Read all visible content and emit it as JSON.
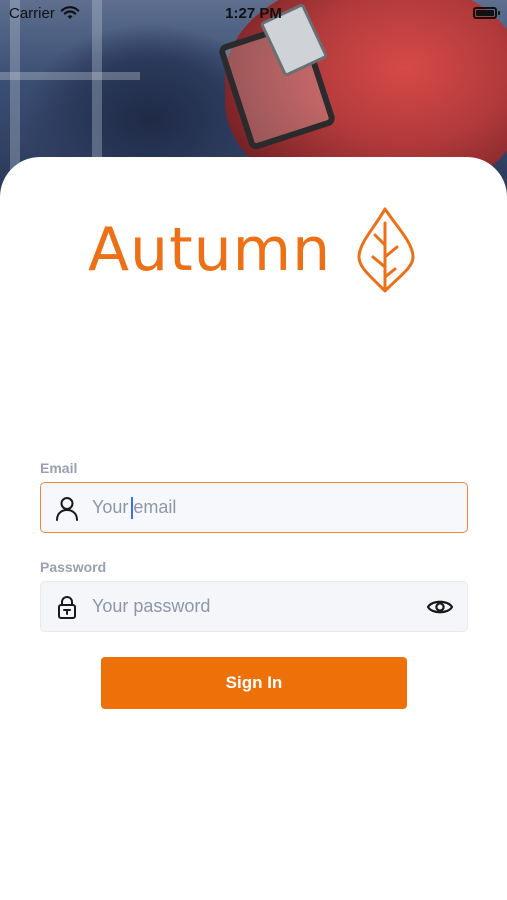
{
  "status_bar": {
    "carrier": "Carrier",
    "time": "1:27 PM"
  },
  "logo": {
    "text": "Autumn",
    "icon": "leaf-icon",
    "color": "#ee7016"
  },
  "email": {
    "label": "Email",
    "placeholder": "Your email",
    "value": "",
    "icon": "user-icon"
  },
  "password": {
    "label": "Password",
    "placeholder": "Your password",
    "value": "",
    "icon": "lock-icon",
    "toggle_icon": "eye-icon"
  },
  "sign_in": {
    "label": "Sign In",
    "color": "#ee7008"
  }
}
